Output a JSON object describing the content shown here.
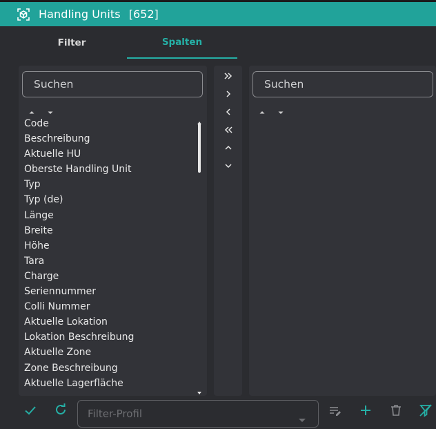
{
  "window": {
    "title": "Handling Units",
    "count": "[652]",
    "accent_color": "#21a39a",
    "logo_icon": "cube-icon"
  },
  "tabs": [
    {
      "label": "Filter",
      "active": false
    },
    {
      "label": "Spalten",
      "active": true
    }
  ],
  "available_columns": {
    "search_placeholder": "Suchen",
    "items": [
      "Code",
      "Beschreibung",
      "Aktuelle HU",
      "Oberste Handling Unit",
      "Typ",
      "Typ (de)",
      "Länge",
      "Breite",
      "Höhe",
      "Tara",
      "Charge",
      "Seriennummer",
      "Colli Nummer",
      "Aktuelle Lokation",
      "Lokation Beschreibung",
      "Aktuelle Zone",
      "Zone Beschreibung",
      "Aktuelle Lagerfläche"
    ]
  },
  "selected_columns": {
    "search_placeholder": "Suchen",
    "items": []
  },
  "move_buttons": [
    "move-all-right-icon",
    "move-right-icon",
    "move-left-icon",
    "move-all-left-icon",
    "move-up-icon",
    "move-down-icon"
  ],
  "footer": {
    "profile_placeholder": "Filter-Profil",
    "icons": [
      "check-icon",
      "refresh-icon",
      "edit-list-icon",
      "add-icon",
      "delete-icon",
      "clear-filter-icon"
    ]
  }
}
